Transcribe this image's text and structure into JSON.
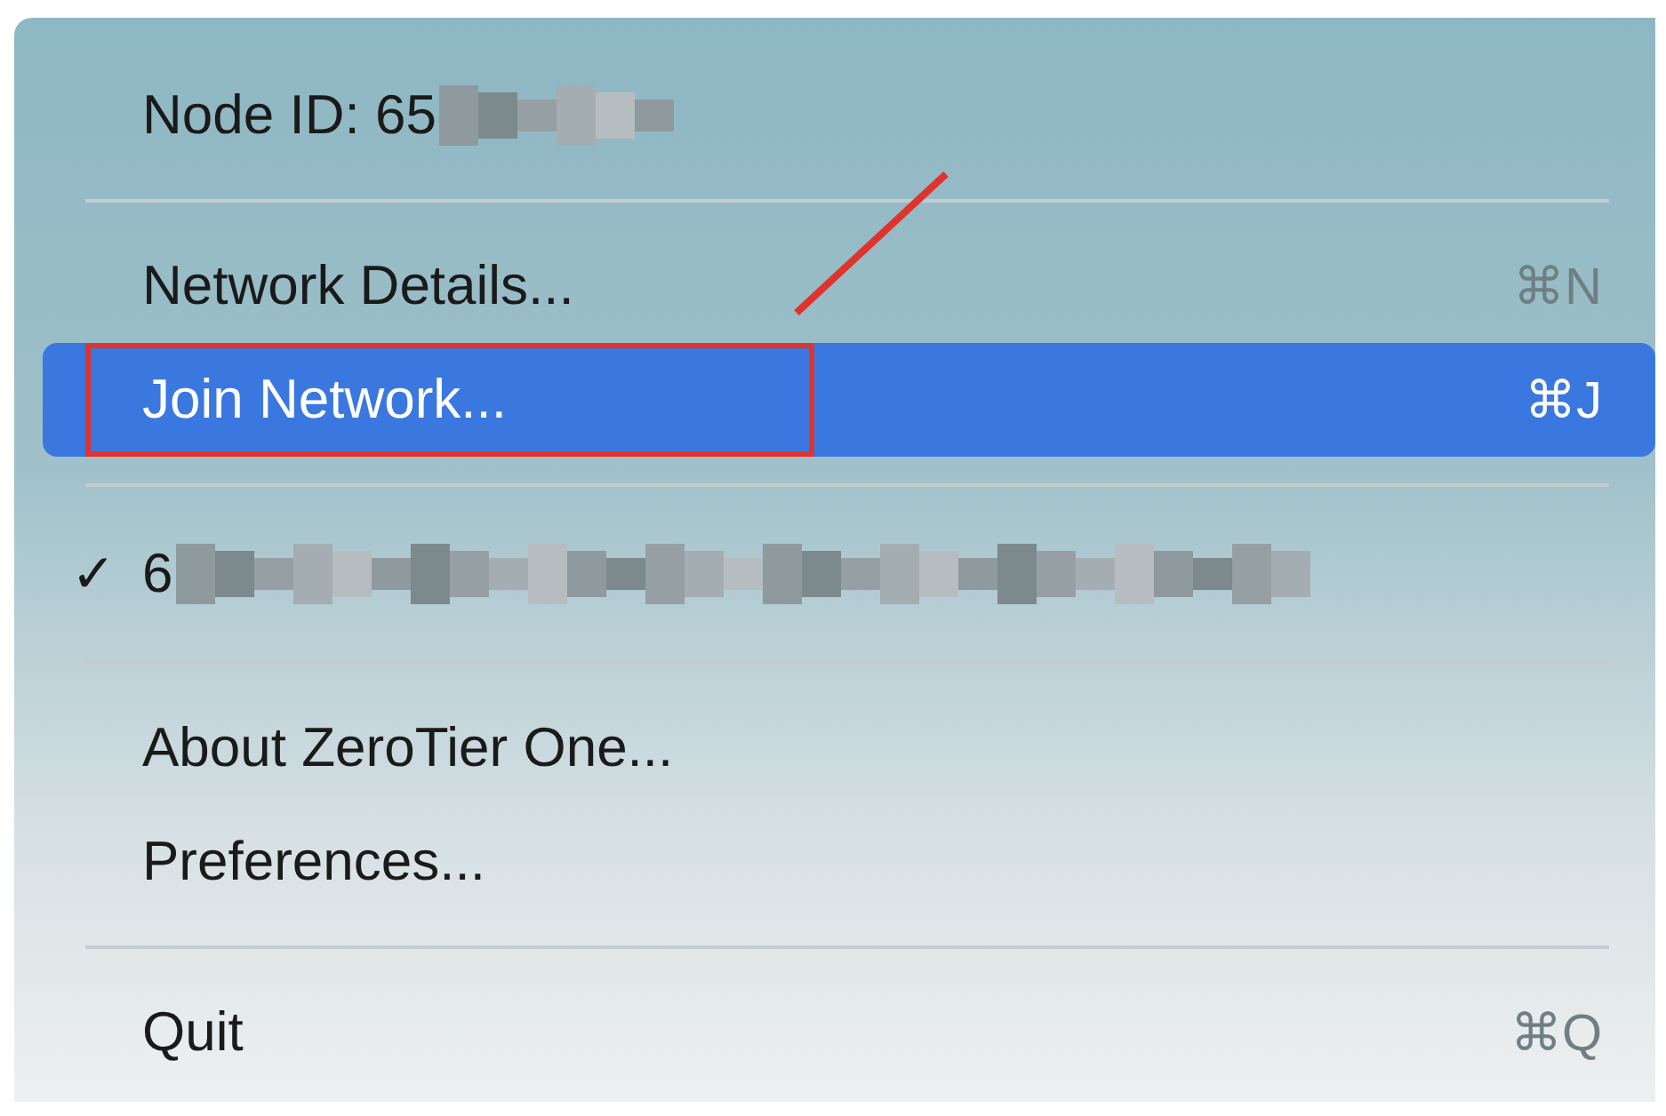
{
  "menu": {
    "items": [
      {
        "kind": "header",
        "label": "Node ID: 65",
        "redacted": true
      },
      {
        "kind": "separator"
      },
      {
        "kind": "item",
        "label": "Network Details...",
        "shortcut": "⌘N",
        "selected": false,
        "annotated": false
      },
      {
        "kind": "item",
        "label": "Join Network...",
        "shortcut": "⌘J",
        "selected": true,
        "annotated": true
      },
      {
        "kind": "separator"
      },
      {
        "kind": "network",
        "label": "6",
        "checked": true,
        "check": "✓",
        "redacted": true
      },
      {
        "kind": "separator"
      },
      {
        "kind": "item",
        "label": "About ZeroTier One...",
        "selected": false,
        "annotated": false
      },
      {
        "kind": "item",
        "label": "Preferences...",
        "selected": false,
        "annotated": false
      },
      {
        "kind": "separator"
      },
      {
        "kind": "item",
        "label": "Quit",
        "shortcut": "⌘Q",
        "selected": false,
        "annotated": false
      }
    ]
  }
}
